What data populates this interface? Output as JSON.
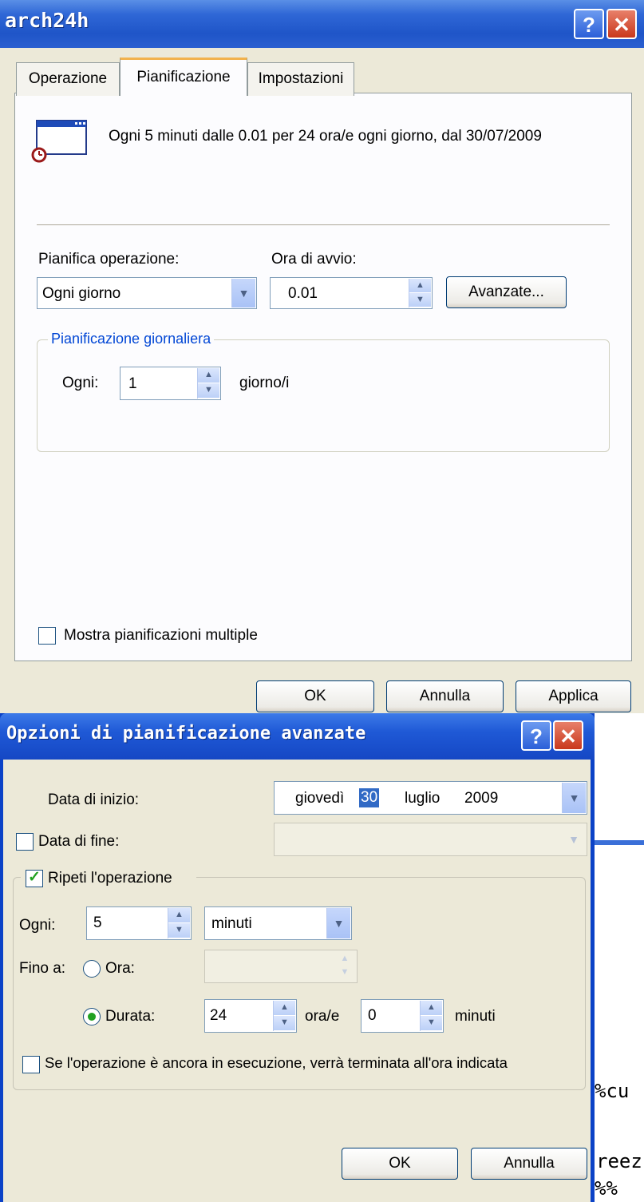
{
  "main_dialog": {
    "title": "arch24h",
    "tabs": [
      {
        "label": "Operazione",
        "active": false
      },
      {
        "label": "Pianificazione",
        "active": true
      },
      {
        "label": "Impostazioni",
        "active": false
      }
    ],
    "summary": "Ogni 5 minuti dalle 0.01 per 24 ora/e ogni giorno, dal 30/07/2009",
    "schedule_label": "Pianifica operazione:",
    "schedule_value": "Ogni giorno",
    "start_time_label": "Ora di avvio:",
    "start_time_value": "0.01",
    "advanced_button": "Avanzate...",
    "daily_group_label": "Pianificazione giornaliera",
    "every_label": "Ogni:",
    "every_value": "1",
    "every_unit": "giorno/i",
    "multiple_checkbox_label": "Mostra pianificazioni multiple",
    "multiple_checked": false,
    "ok_button": "OK",
    "cancel_button": "Annulla",
    "apply_button": "Applica"
  },
  "advanced_dialog": {
    "title": "Opzioni di pianificazione avanzate",
    "start_date_label": "Data di inizio:",
    "start_date": {
      "weekday": "giovedì",
      "day": "30",
      "month": "luglio",
      "year": "2009"
    },
    "end_date_label": "Data di fine:",
    "end_date_checked": false,
    "repeat_label": "Ripeti l'operazione",
    "repeat_checked": true,
    "every_label": "Ogni:",
    "every_value": "5",
    "every_unit": "minuti",
    "until_label": "Fino a:",
    "time_option_label": "Ora:",
    "duration_option_label": "Durata:",
    "duration_selected": true,
    "duration_hours": "24",
    "hours_unit": "ora/e",
    "duration_minutes": "0",
    "minutes_unit": "minuti",
    "terminate_label": "Se l'operazione è ancora in esecuzione, verrà terminata all'ora indicata",
    "terminate_checked": false,
    "ok_button": "OK",
    "cancel_button": "Annulla"
  },
  "background_text": [
    "%cu",
    "reez",
    "%%"
  ],
  "colors": {
    "title_bar": "#2f67d6",
    "dialog_bg": "#ece9d8",
    "tab_highlight": "#f2b24c",
    "group_label": "#0046d5"
  },
  "icons": [
    "help-icon",
    "close-icon",
    "scheduled-task-icon",
    "dropdown-arrow-icon",
    "spin-icon",
    "checkmark-icon"
  ]
}
